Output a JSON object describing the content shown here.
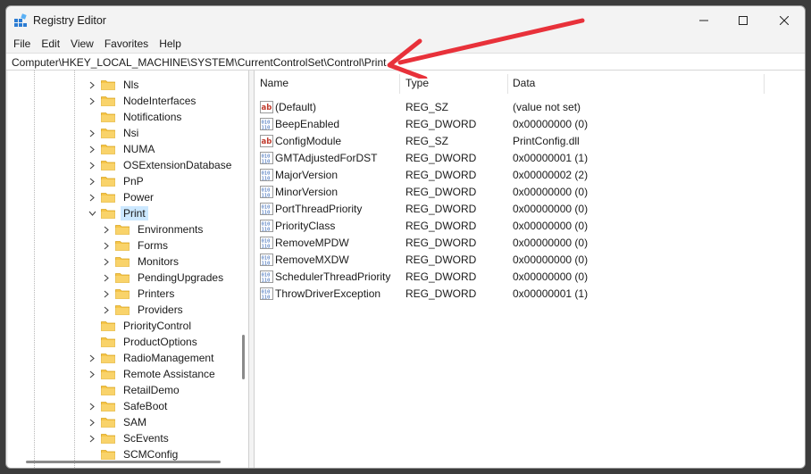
{
  "window": {
    "title": "Registry Editor"
  },
  "menu": [
    "File",
    "Edit",
    "View",
    "Favorites",
    "Help"
  ],
  "address": "Computer\\HKEY_LOCAL_MACHINE\\SYSTEM\\CurrentControlSet\\Control\\Print",
  "tree": [
    {
      "label": "Nls",
      "level": 0,
      "chevron": "right",
      "selected": false
    },
    {
      "label": "NodeInterfaces",
      "level": 0,
      "chevron": "right",
      "selected": false
    },
    {
      "label": "Notifications",
      "level": 0,
      "chevron": "none",
      "selected": false
    },
    {
      "label": "Nsi",
      "level": 0,
      "chevron": "right",
      "selected": false
    },
    {
      "label": "NUMA",
      "level": 0,
      "chevron": "right",
      "selected": false
    },
    {
      "label": "OSExtensionDatabase",
      "level": 0,
      "chevron": "right",
      "selected": false
    },
    {
      "label": "PnP",
      "level": 0,
      "chevron": "right",
      "selected": false
    },
    {
      "label": "Power",
      "level": 0,
      "chevron": "right",
      "selected": false
    },
    {
      "label": "Print",
      "level": 0,
      "chevron": "down",
      "selected": true
    },
    {
      "label": "Environments",
      "level": 1,
      "chevron": "right",
      "selected": false
    },
    {
      "label": "Forms",
      "level": 1,
      "chevron": "right",
      "selected": false
    },
    {
      "label": "Monitors",
      "level": 1,
      "chevron": "right",
      "selected": false
    },
    {
      "label": "PendingUpgrades",
      "level": 1,
      "chevron": "right",
      "selected": false
    },
    {
      "label": "Printers",
      "level": 1,
      "chevron": "right",
      "selected": false
    },
    {
      "label": "Providers",
      "level": 1,
      "chevron": "right",
      "selected": false
    },
    {
      "label": "PriorityControl",
      "level": 0,
      "chevron": "none",
      "selected": false
    },
    {
      "label": "ProductOptions",
      "level": 0,
      "chevron": "none",
      "selected": false
    },
    {
      "label": "RadioManagement",
      "level": 0,
      "chevron": "right",
      "selected": false
    },
    {
      "label": "Remote Assistance",
      "level": 0,
      "chevron": "right",
      "selected": false
    },
    {
      "label": "RetailDemo",
      "level": 0,
      "chevron": "none",
      "selected": false
    },
    {
      "label": "SafeBoot",
      "level": 0,
      "chevron": "right",
      "selected": false
    },
    {
      "label": "SAM",
      "level": 0,
      "chevron": "right",
      "selected": false
    },
    {
      "label": "ScEvents",
      "level": 0,
      "chevron": "right",
      "selected": false
    },
    {
      "label": "SCMConfig",
      "level": 0,
      "chevron": "none",
      "selected": false
    }
  ],
  "columns": [
    "Name",
    "Type",
    "Data"
  ],
  "values": [
    {
      "name": "(Default)",
      "type": "REG_SZ",
      "data": "(value not set)",
      "icon": "string-value-icon"
    },
    {
      "name": "BeepEnabled",
      "type": "REG_DWORD",
      "data": "0x00000000 (0)",
      "icon": "binary-value-icon"
    },
    {
      "name": "ConfigModule",
      "type": "REG_SZ",
      "data": "PrintConfig.dll",
      "icon": "string-value-icon"
    },
    {
      "name": "GMTAdjustedForDST",
      "type": "REG_DWORD",
      "data": "0x00000001 (1)",
      "icon": "binary-value-icon"
    },
    {
      "name": "MajorVersion",
      "type": "REG_DWORD",
      "data": "0x00000002 (2)",
      "icon": "binary-value-icon"
    },
    {
      "name": "MinorVersion",
      "type": "REG_DWORD",
      "data": "0x00000000 (0)",
      "icon": "binary-value-icon"
    },
    {
      "name": "PortThreadPriority",
      "type": "REG_DWORD",
      "data": "0x00000000 (0)",
      "icon": "binary-value-icon"
    },
    {
      "name": "PriorityClass",
      "type": "REG_DWORD",
      "data": "0x00000000 (0)",
      "icon": "binary-value-icon"
    },
    {
      "name": "RemoveMPDW",
      "type": "REG_DWORD",
      "data": "0x00000000 (0)",
      "icon": "binary-value-icon"
    },
    {
      "name": "RemoveMXDW",
      "type": "REG_DWORD",
      "data": "0x00000000 (0)",
      "icon": "binary-value-icon"
    },
    {
      "name": "SchedulerThreadPriority",
      "type": "REG_DWORD",
      "data": "0x00000000 (0)",
      "icon": "binary-value-icon"
    },
    {
      "name": "ThrowDriverException",
      "type": "REG_DWORD",
      "data": "0x00000001 (1)",
      "icon": "binary-value-icon"
    }
  ],
  "colors": {
    "selection": "#cce8ff",
    "folder": "#f6c548",
    "annotation_arrow": "#e8313a",
    "dword_icon": "#2b5fb3",
    "string_icon": "#c0392b"
  }
}
